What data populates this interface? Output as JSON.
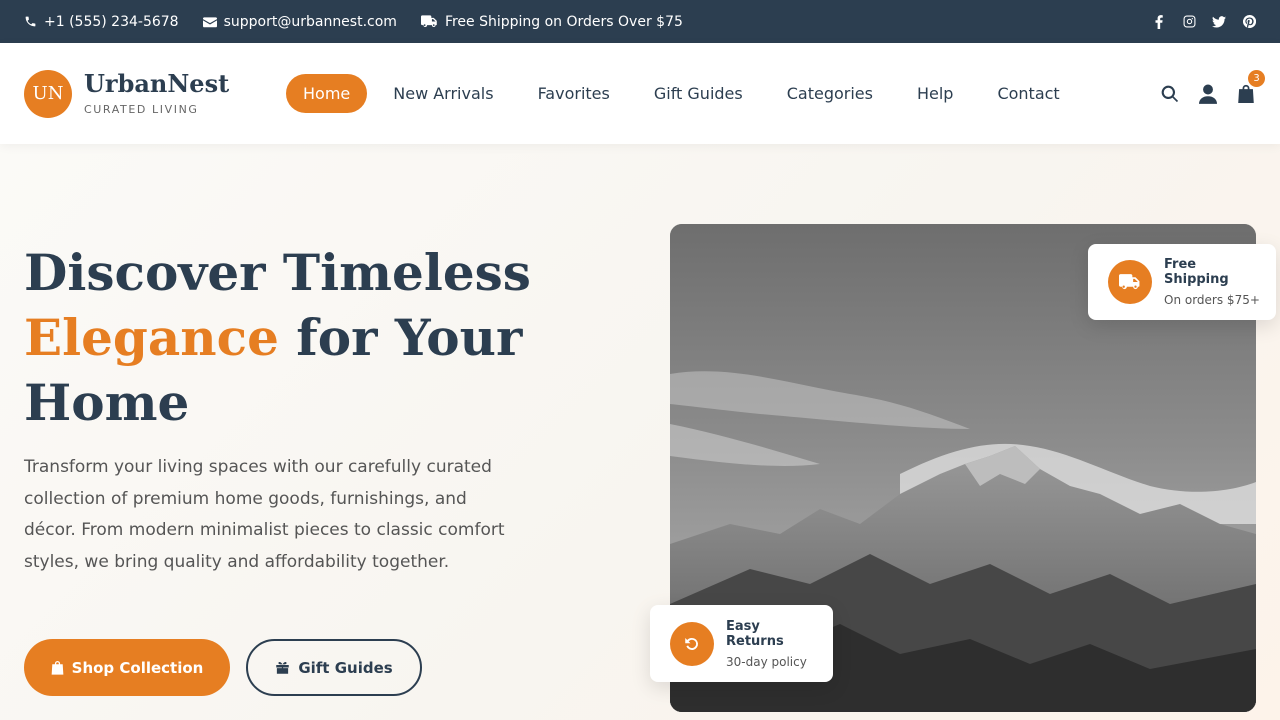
{
  "topbar": {
    "phone": "+1 (555) 234-5678",
    "email": "support@urbannest.com",
    "shipping": "Free Shipping on Orders Over $75",
    "social": [
      "facebook-icon",
      "instagram-icon",
      "twitter-icon",
      "pinterest-icon"
    ]
  },
  "brand": {
    "initials": "UN",
    "name": "UrbanNest",
    "tagline": "CURATED LIVING"
  },
  "nav": {
    "items": [
      "Home",
      "New Arrivals",
      "Favorites",
      "Gift Guides",
      "Categories",
      "Help",
      "Contact"
    ],
    "active": "Home"
  },
  "header_icons": {
    "icons": [
      "search-icon",
      "user-icon",
      "shopping-bag-icon"
    ],
    "cart_count": "3"
  },
  "hero": {
    "title_part1": "Discover Timeless",
    "title_accent": "Elegance",
    "title_part2": " for Your Home",
    "description": "Transform your living spaces with our carefully curated collection of premium home goods, furnishings, and décor. From modern minimalist pieces to classic comfort styles, we bring quality and affordability together.",
    "primary_button": "Shop Collection",
    "secondary_button": "Gift Guides"
  },
  "feature_cards": {
    "shipping": {
      "title": "Free Shipping",
      "subtitle": "On orders $75+"
    },
    "returns": {
      "title": "Easy Returns",
      "subtitle": "30-day policy"
    }
  },
  "colors": {
    "accent": "#e67e22",
    "navy": "#2c3e50",
    "hero_bg": "#f8f5f0"
  }
}
